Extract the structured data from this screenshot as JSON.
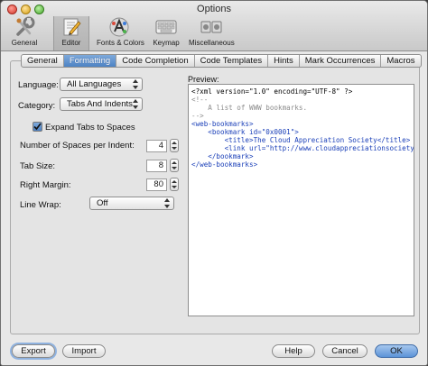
{
  "window": {
    "title": "Options"
  },
  "toolbar": {
    "items": [
      {
        "label": "General",
        "icon": "general-icon"
      },
      {
        "label": "Editor",
        "icon": "editor-icon",
        "selected": true
      },
      {
        "label": "Fonts & Colors",
        "icon": "fonts-colors-icon"
      },
      {
        "label": "Keymap",
        "icon": "keymap-icon"
      },
      {
        "label": "Miscellaneous",
        "icon": "miscellaneous-icon"
      }
    ]
  },
  "tabs": [
    {
      "label": "General"
    },
    {
      "label": "Formatting",
      "active": true
    },
    {
      "label": "Code Completion"
    },
    {
      "label": "Code Templates"
    },
    {
      "label": "Hints"
    },
    {
      "label": "Mark Occurrences"
    },
    {
      "label": "Macros"
    }
  ],
  "form": {
    "language_label": "Language:",
    "language_value": "All Languages",
    "category_label": "Category:",
    "category_value": "Tabs And Indents",
    "expand_tabs_label": "Expand Tabs to Spaces",
    "expand_tabs_checked": true,
    "spaces_per_indent_label": "Number of Spaces per Indent:",
    "spaces_per_indent_value": "4",
    "tab_size_label": "Tab Size:",
    "tab_size_value": "8",
    "right_margin_label": "Right Margin:",
    "right_margin_value": "80",
    "line_wrap_label": "Line Wrap:",
    "line_wrap_value": "Off"
  },
  "preview": {
    "label": "Preview:",
    "lines": [
      "<?xml version=\"1.0\" encoding=\"UTF-8\" ?>",
      "<!--",
      "    A list of WWW bookmarks.",
      "-->",
      "<web-bookmarks>",
      "    <bookmark id=\"0x0001\">",
      "        <title>The Cloud Appreciation Society</title>",
      "        <link url=\"http://www.cloudappreciationsociety.org\"/>",
      "    </bookmark>",
      "</web-bookmarks>"
    ]
  },
  "buttons": {
    "export": "Export",
    "import": "Import",
    "help": "Help",
    "cancel": "Cancel",
    "ok": "OK"
  },
  "colors": {
    "tab_active": "#4d82c4",
    "xml_tag": "#1a3fb8",
    "xml_attr": "#1a8d8d",
    "xml_value": "#b5201b",
    "xml_comment": "#8c8c8c"
  }
}
